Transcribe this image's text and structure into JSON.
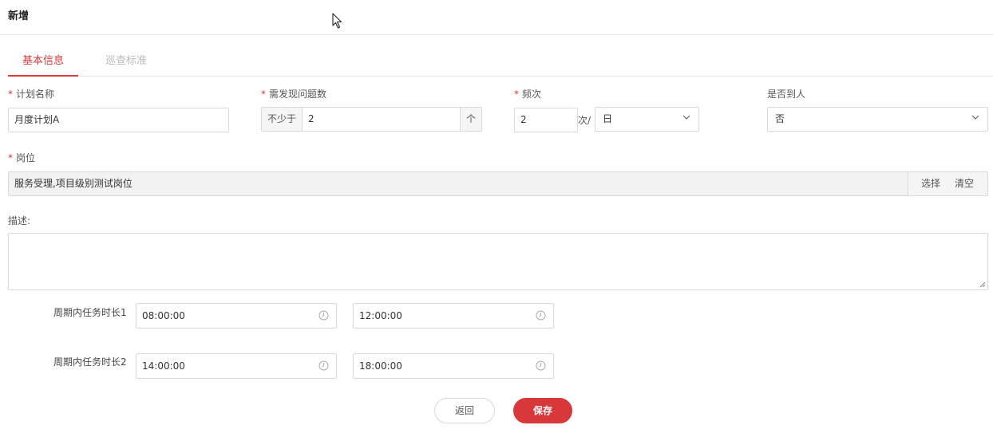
{
  "header": {
    "title": "新增"
  },
  "tabs": [
    {
      "label": "基本信息",
      "active": true
    },
    {
      "label": "巡查标准",
      "active": false
    }
  ],
  "form": {
    "plan_name": {
      "label": "计划名称",
      "required": true,
      "value": "月度计划A"
    },
    "issues_required": {
      "label": "需发现问题数",
      "required": true,
      "prefix": "不少于",
      "value": "2",
      "suffix": "个"
    },
    "frequency": {
      "label": "频次",
      "required": true,
      "count": "2",
      "unit_text": "次/",
      "period": "日"
    },
    "on_site": {
      "label": "是否到人",
      "required": false,
      "value": "否"
    },
    "position": {
      "label": "岗位",
      "required": true,
      "value": "服务受理,项目级别测试岗位",
      "select_label": "选择",
      "clear_label": "清空"
    },
    "description": {
      "label": "描述:",
      "value": ""
    },
    "durations": [
      {
        "label": "周期内任务时长1",
        "start": "08:00:00",
        "end": "12:00:00"
      },
      {
        "label": "周期内任务时长2",
        "start": "14:00:00",
        "end": "18:00:00"
      }
    ]
  },
  "actions": {
    "back_label": "返回",
    "save_label": "保存"
  },
  "colors": {
    "accent": "#d9383a",
    "border": "#d9d9d9",
    "muted": "#bbbbbb"
  },
  "icons": {
    "dropdown": "chevron-down-icon",
    "time": "clock-icon",
    "cursor": "mouse-pointer-icon"
  }
}
